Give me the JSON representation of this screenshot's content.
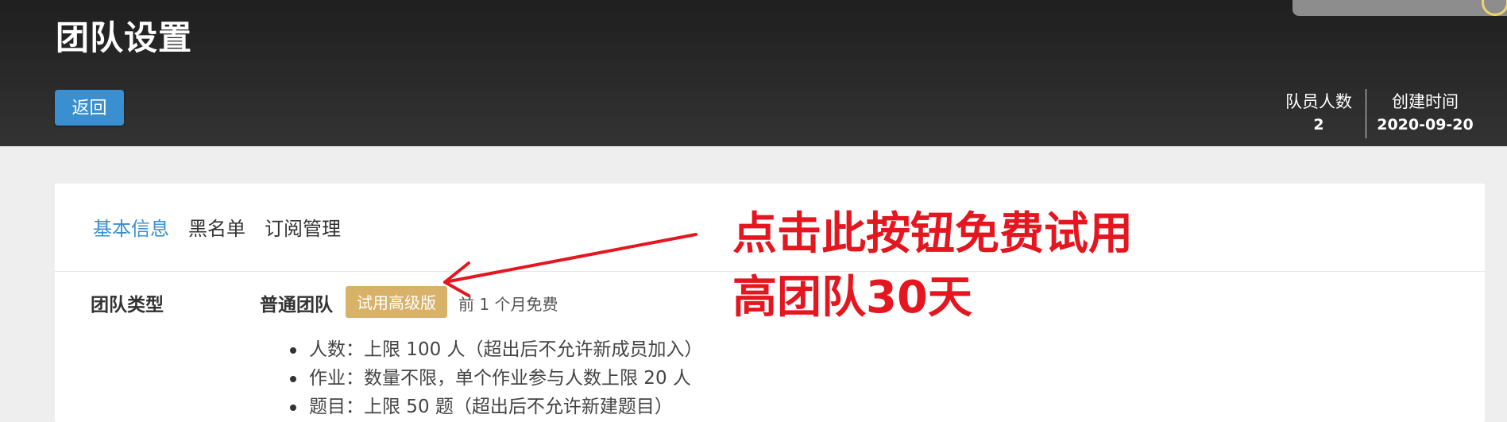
{
  "header": {
    "title": "团队设置",
    "back_label": "返回",
    "stats": {
      "members_label": "队员人数",
      "members_value": "2",
      "created_label": "创建时间",
      "created_value": "2020-09-20"
    }
  },
  "tabs": [
    {
      "label": "基本信息",
      "active": true
    },
    {
      "label": "黑名单",
      "active": false
    },
    {
      "label": "订阅管理",
      "active": false
    }
  ],
  "team_type": {
    "label": "团队类型",
    "value": "普通团队",
    "trial_button": "试用高级版",
    "trial_note": "前 1 个月免费"
  },
  "features": [
    "人数：上限 100 人（超出后不允许新成员加入）",
    "作业：数量不限，单个作业参与人数上限 20 人",
    "题目：上限 50 题（超出后不允许新建题目）"
  ],
  "annotation": {
    "line1": "点击此按钮免费试用",
    "line2": "高团队30天"
  },
  "colors": {
    "accent_blue": "#3a8fd0",
    "trial_gold": "#d9b26a",
    "annotation_red": "#e4161f",
    "header_dark": "#2a2a2b"
  }
}
